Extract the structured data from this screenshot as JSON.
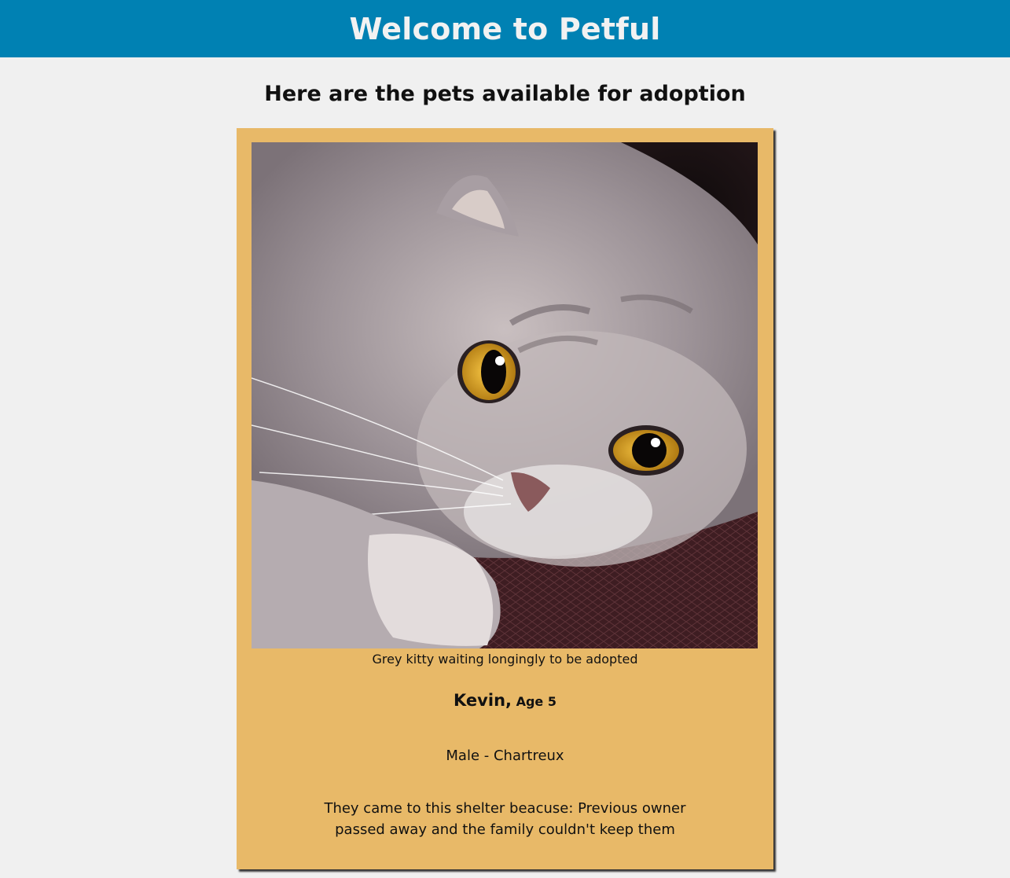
{
  "header": {
    "title": "Welcome to Petful"
  },
  "main": {
    "subtitle": "Here are the pets available for adoption",
    "pet": {
      "image_alt": "Grey kitty waiting longingly to be adopted",
      "caption": "Grey kitty waiting longingly to be adopted",
      "name": "Kevin,",
      "age": "Age 5",
      "gender_breed": "Male - Chartreux",
      "story": "They came to this shelter beacuse: Previous owner passed away and the family couldn't keep them"
    }
  },
  "colors": {
    "header_bg": "#0081b3",
    "page_bg": "#f0f0f0",
    "card_bg": "#e8b968"
  }
}
